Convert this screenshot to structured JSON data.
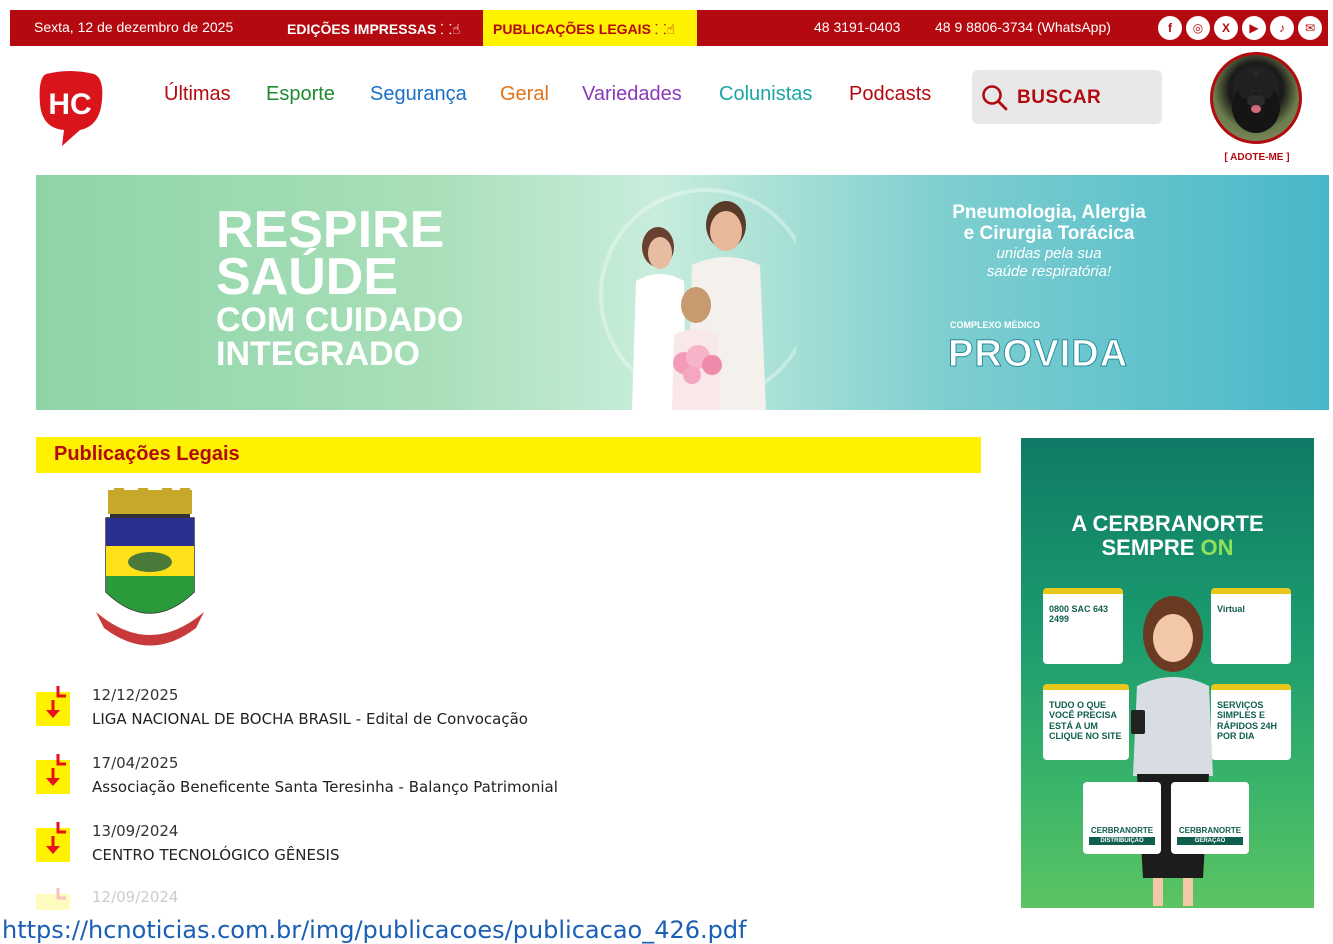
{
  "topbar": {
    "date": "Sexta, 12 de dezembro de 2025",
    "edicoes_label": "EDIÇÕES IMPRESSAS",
    "legais_label": "PUBLICAÇÕES LEGAIS",
    "phone": "48 3191-0403",
    "whatsapp": "48 9 8806-3734 (WhatsApp)",
    "social": [
      "facebook-icon",
      "instagram-icon",
      "x-icon",
      "youtube-icon",
      "tiktok-icon",
      "email-icon"
    ],
    "colors": {
      "bar": "#b3090f",
      "highlight": "#fff200"
    }
  },
  "header": {
    "logo_text": "HC",
    "nav": [
      {
        "label": "Últimas",
        "color": "#b3090f"
      },
      {
        "label": "Esporte",
        "color": "#1f8a2e"
      },
      {
        "label": "Segurança",
        "color": "#1a6fc4"
      },
      {
        "label": "Geral",
        "color": "#e0731a"
      },
      {
        "label": "Variedades",
        "color": "#8a3ab8"
      },
      {
        "label": "Colunistas",
        "color": "#1aa6a6"
      },
      {
        "label": "Podcasts",
        "color": "#b3090f"
      }
    ],
    "search_label": "BUSCAR",
    "adopt_label": "[ ADOTE-ME ]"
  },
  "banner": {
    "headline_1": "RESPIRE",
    "headline_2": "SAÚDE",
    "headline_3": "COM CUIDADO",
    "headline_4": "INTEGRADO",
    "right_title_1": "Pneumologia, Alergia",
    "right_title_2": "e Cirurgia Torácica",
    "right_sub_1": "unidas pela sua",
    "right_sub_2": "saúde respiratória!",
    "small_label": "COMPLEXO MÉDICO",
    "brand": "PROVIDA"
  },
  "publicacoes": {
    "title": "Publicações Legais",
    "items": [
      {
        "date": "12/12/2025",
        "title": "LIGA NACIONAL DE BOCHA BRASIL - Edital de Convocação"
      },
      {
        "date": "17/04/2025",
        "title": "Associação Beneficente Santa Teresinha - Balanço Patrimonial"
      },
      {
        "date": "13/09/2024",
        "title": "CENTRO TECNOLÓGICO GÊNESIS"
      },
      {
        "date": "12/09/2024",
        "title": ""
      }
    ]
  },
  "side_ad": {
    "title_1": "A CERBRANORTE",
    "title_2": "SEMPRE",
    "title_3": "ON",
    "card_1": "0800 SAC 643 2499",
    "card_2": "Virtual",
    "card_3": "TUDO O QUE VOCÊ PRECISA ESTÁ A UM CLIQUE NO SITE",
    "card_4": "SERVIÇOS SIMPLES E RÁPIDOS 24H POR DIA",
    "brand_1": "CERBRANORTE",
    "brand_1_sub": "DISTRIBUIÇÃO",
    "brand_2": "CERBRANORTE",
    "brand_2_sub": "GERAÇÃO"
  },
  "status": {
    "url": "https://hcnoticias.com.br/img/publicacoes/publicacao_426.pdf"
  }
}
